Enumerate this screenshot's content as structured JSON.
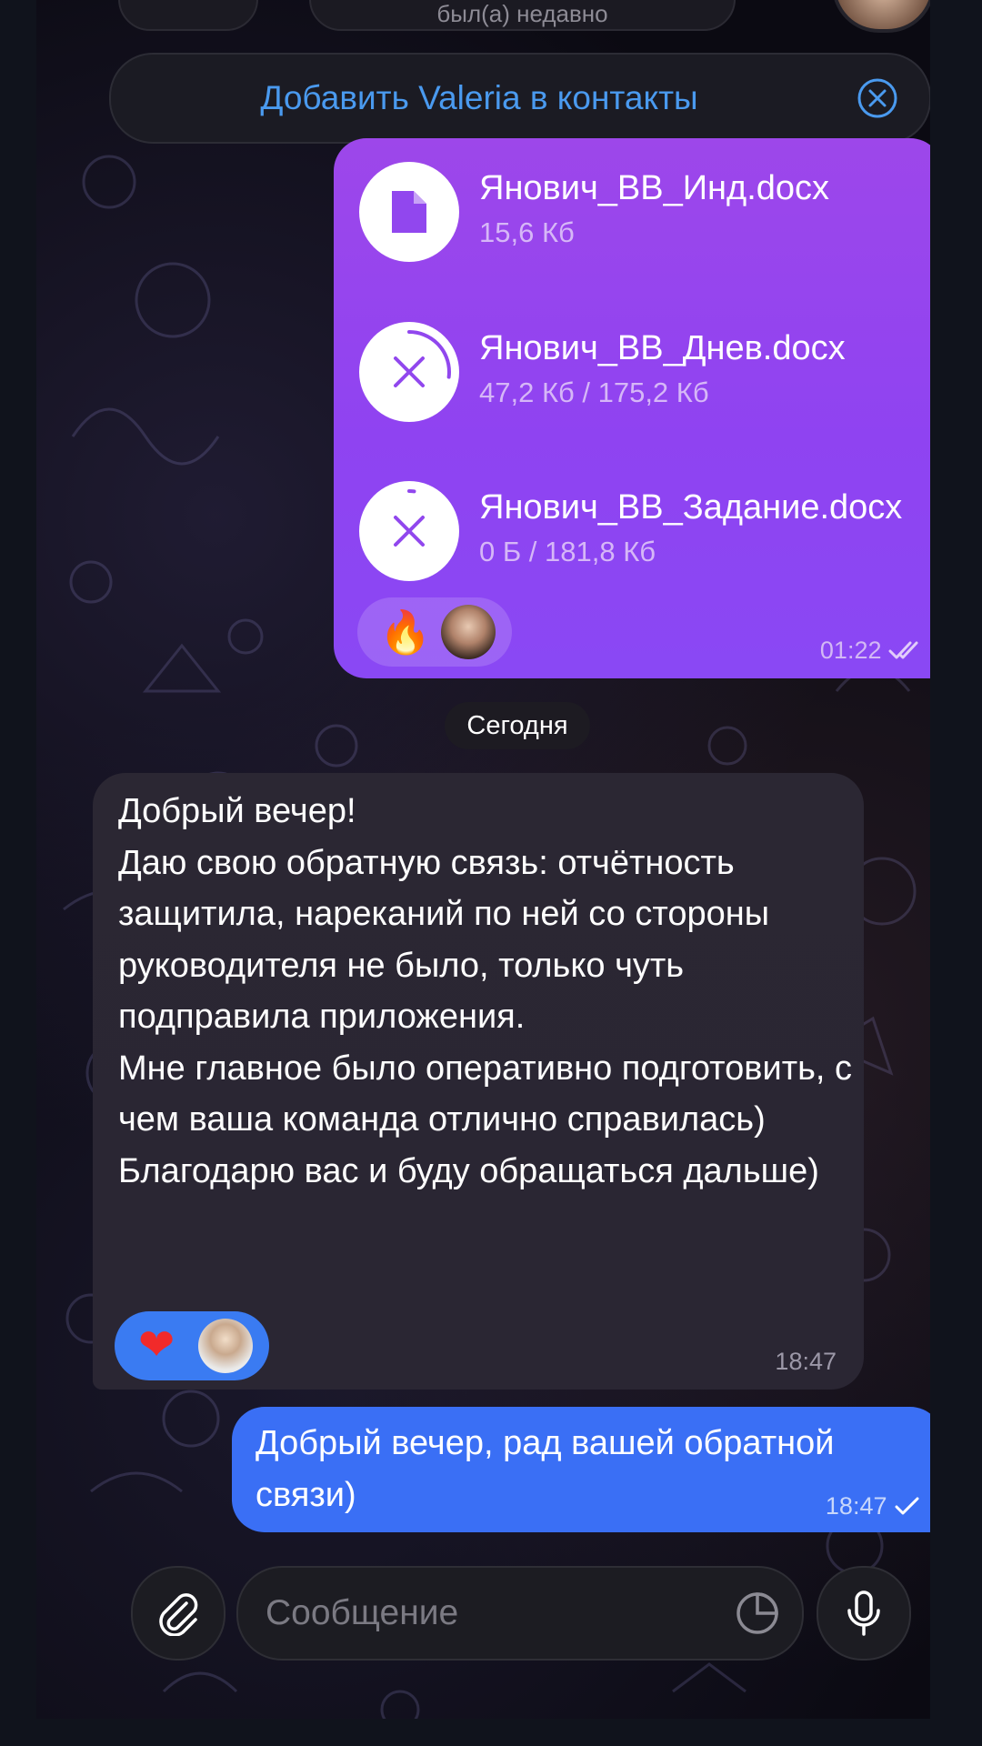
{
  "header": {
    "status": "был(а) недавно"
  },
  "add_contact": {
    "label": "Добавить Valeria в контакты",
    "close_icon": "close-circle-icon"
  },
  "messages": {
    "files": {
      "items": [
        {
          "name": "Янович_ВВ_Инд.docx",
          "size": "15,6 Кб",
          "state": "downloaded",
          "icon": "file-icon"
        },
        {
          "name": "Янович_ВВ_Днев.docx",
          "size": "47,2 Кб / 175,2 Кб",
          "state": "downloading",
          "progress": 0.27,
          "icon": "cancel-icon"
        },
        {
          "name": "Янович_ВВ_Задание.docx",
          "size": "0 Б / 181,8 Кб",
          "state": "downloading",
          "progress": 0.02,
          "icon": "cancel-icon"
        }
      ],
      "reaction": "🔥",
      "time": "01:22",
      "status_icon": "double-check-icon"
    },
    "date_divider": "Сегодня",
    "incoming": {
      "text": "Добрый вечер!\nДаю свою обратную связь: отчётность защитила, нареканий по ней со стороны руководителя не было, только чуть подправила приложения.\nМне главное было оперативно подготовить, с чем ваша команда отлично справилась)\nБлагодарю вас и буду обращаться дальше)",
      "reaction": "❤",
      "time": "18:47"
    },
    "outgoing": {
      "text": "Добрый вечер, рад вашей обратной связи)",
      "time": "18:47",
      "status_icon": "single-check-icon"
    }
  },
  "composer": {
    "placeholder": "Сообщение",
    "attach_icon": "paperclip-icon",
    "sticker_icon": "sticker-icon",
    "mic_icon": "microphone-icon"
  },
  "colors": {
    "accent_link": "#4a9aef",
    "files_bubble": "#9147ee",
    "outgoing_bubble": "#3a6ff5",
    "incoming_bubble": "#2b2733",
    "reaction_me": "#3a7bf2"
  }
}
